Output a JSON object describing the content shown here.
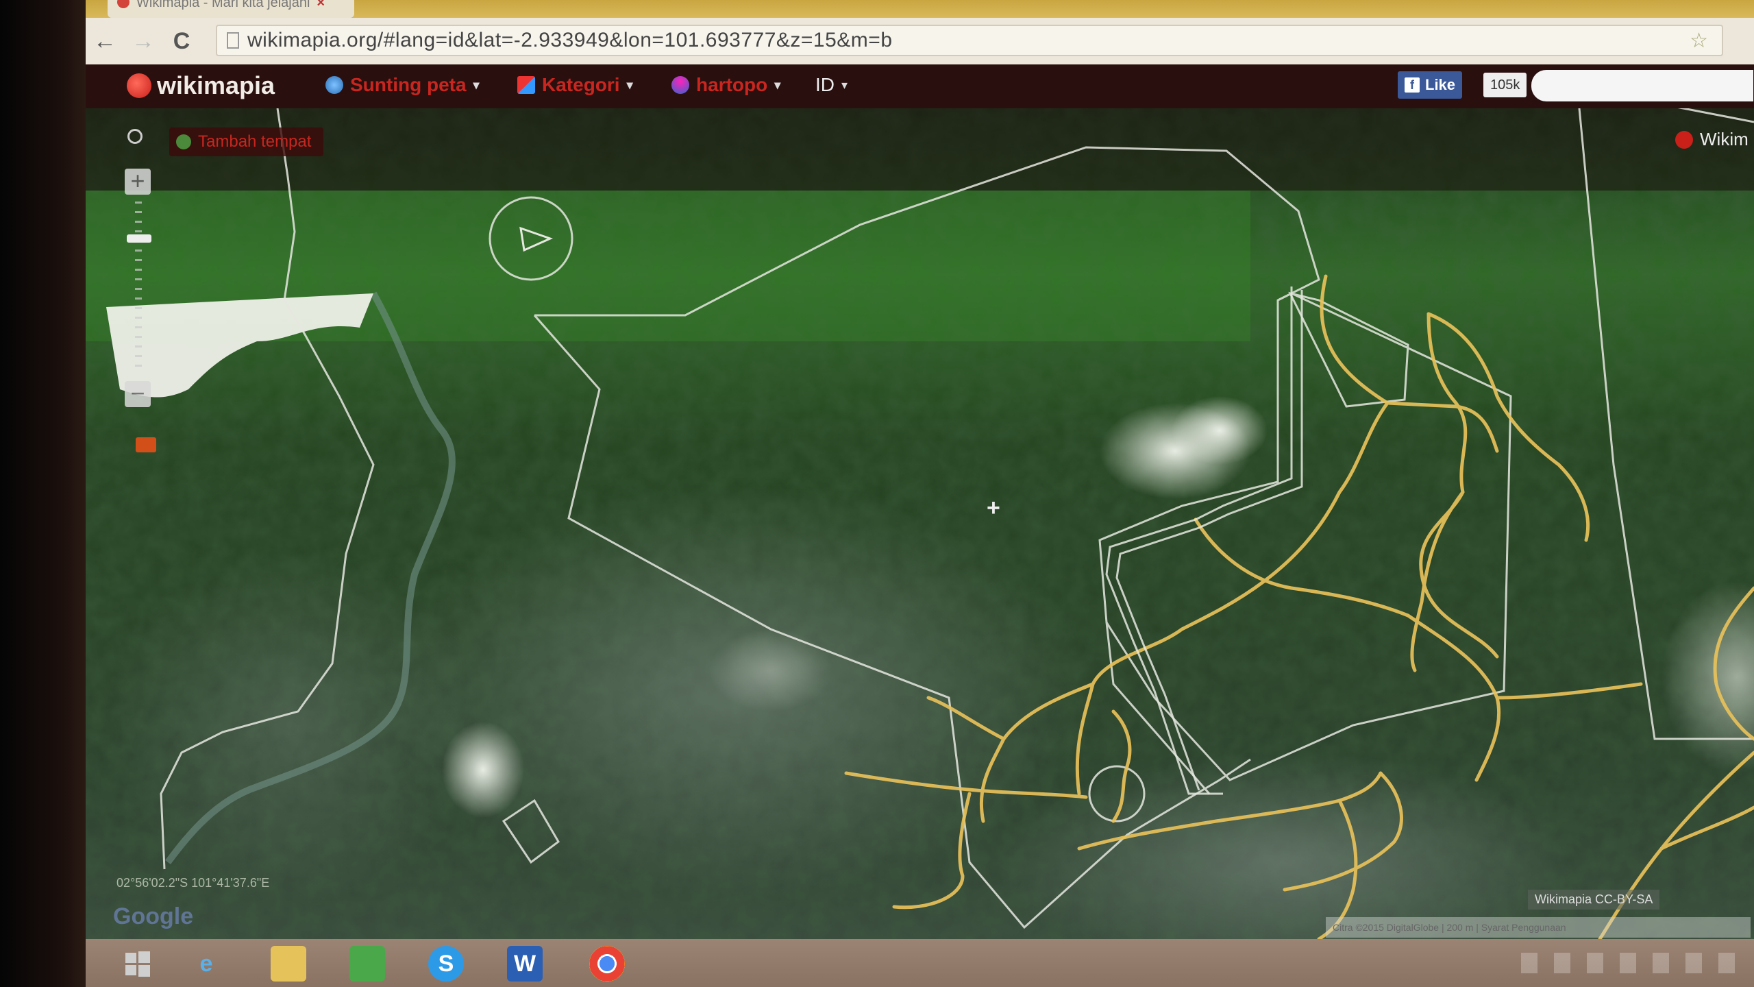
{
  "browser": {
    "tab_title": "Wikimapia - Mari kita jelajahi",
    "tab_close": "×",
    "url": "wikimapia.org/#lang=id&lat=-2.933949&lon=101.693777&z=15&m=b",
    "back_glyph": "←",
    "forward_glyph": "→",
    "reload_glyph": "C",
    "star_glyph": "☆"
  },
  "header": {
    "logo_text": "wikimapia",
    "menu": [
      {
        "label": "Sunting peta",
        "icon": "globe-icon"
      },
      {
        "label": "Kategori",
        "icon": "category-icon"
      },
      {
        "label": "hartopo",
        "icon": "user-icon"
      },
      {
        "label": "ID",
        "icon": ""
      }
    ],
    "caret": "▾",
    "fb_like_label": "Like",
    "fb_like_count": "105k"
  },
  "map": {
    "add_place_label": "Tambah tempat",
    "zoom_in": "+",
    "zoom_out": "−",
    "center_marker": "+",
    "wiki_tab_label": "Wikim",
    "coordinates": "02°56'02.2\"S 101°41'37.6\"E",
    "google_label": "Google",
    "copyright": "Wikimapia CC-BY-SA",
    "attribution": "Citra ©2015 DigitalGlobe   |   200 m   |   Syarat Penggunaan"
  },
  "taskbar": {
    "icons": [
      "start-icon",
      "ie-icon",
      "explorer-icon",
      "store-icon",
      "skype-icon",
      "word-icon",
      "chrome-icon"
    ]
  },
  "colors": {
    "brand_red": "#c8261f",
    "road_yellow": "#e8c15a",
    "boundary_white": "#e6e8e0"
  }
}
